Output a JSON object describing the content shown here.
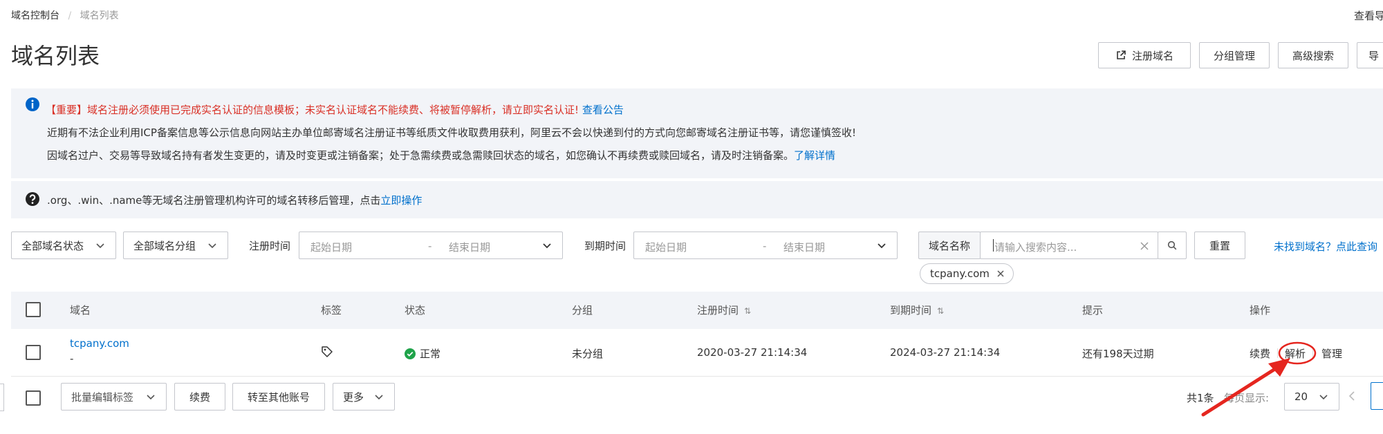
{
  "breadcrumb": {
    "root": "域名控制台",
    "sep": "/",
    "current": "域名列表"
  },
  "top_right_cut": "查看导",
  "page_title": "域名列表",
  "header_buttons": {
    "register": "注册域名",
    "group": "分组管理",
    "advanced_search": "高级搜索",
    "cut": "导"
  },
  "notice": {
    "tag": "【重要】",
    "line1": "域名注册必须使用已完成实名认证的信息模板；未实名认证域名不能续费、将被暂停解析，请立即实名认证!",
    "line1_link": "查看公告",
    "line2": "近期有不法企业利用ICP备案信息等公示信息向网站主办单位邮寄域名注册证书等纸质文件收取费用获利，阿里云不会以快递到付的方式向您邮寄域名注册证书等，请您谨慎签收!",
    "line3": "因域名过户、交易等导致域名持有者发生变更的，请及时变更或注销备案；处于急需续费或急需赎回状态的域名，如您确认不再续费或赎回域名，请及时注销备案。",
    "line3_link": "了解详情"
  },
  "notice2": {
    "text": ".org、.win、.name等无域名注册管理机构许可的域名转移后管理，点击",
    "link": "立即操作"
  },
  "filters": {
    "status": "全部域名状态",
    "group": "全部域名分组",
    "reg_time_label": "注册时间",
    "exp_time_label": "到期时间",
    "start_date": "起始日期",
    "date_sep": "-",
    "end_date": "结束日期",
    "search_field": "域名名称",
    "search_placeholder": "请输入搜索内容...",
    "reset": "重置",
    "not_found_link": "未找到域名？点此查询",
    "active_tag": "tcpany.com"
  },
  "table": {
    "headers": {
      "domain": "域名",
      "tags": "标签",
      "status": "状态",
      "group": "分组",
      "reg_time": "注册时间",
      "exp_time": "到期时间",
      "hint": "提示",
      "actions": "操作"
    },
    "rows": [
      {
        "domain": "tcpany.com",
        "sub": "-",
        "status": "正常",
        "group": "未分组",
        "reg_time": "2020-03-27 21:14:34",
        "exp_time": "2024-03-27 21:14:34",
        "hint": "还有198天过期",
        "action_renew": "续费",
        "action_resolve": "解析",
        "action_manage": "管理"
      }
    ]
  },
  "footer": {
    "batch_tags": "批量编辑标签",
    "renew": "续费",
    "transfer": "转至其他账号",
    "more": "更多",
    "total": "共1条",
    "per_page_label": "每页显示:",
    "per_page": "20"
  },
  "colors": {
    "link": "#0070cc",
    "alert_red": "#d93026",
    "ok_green": "#1fa34a",
    "annotation_red": "#e5261f",
    "notice_bg": "#f2f4f8"
  }
}
